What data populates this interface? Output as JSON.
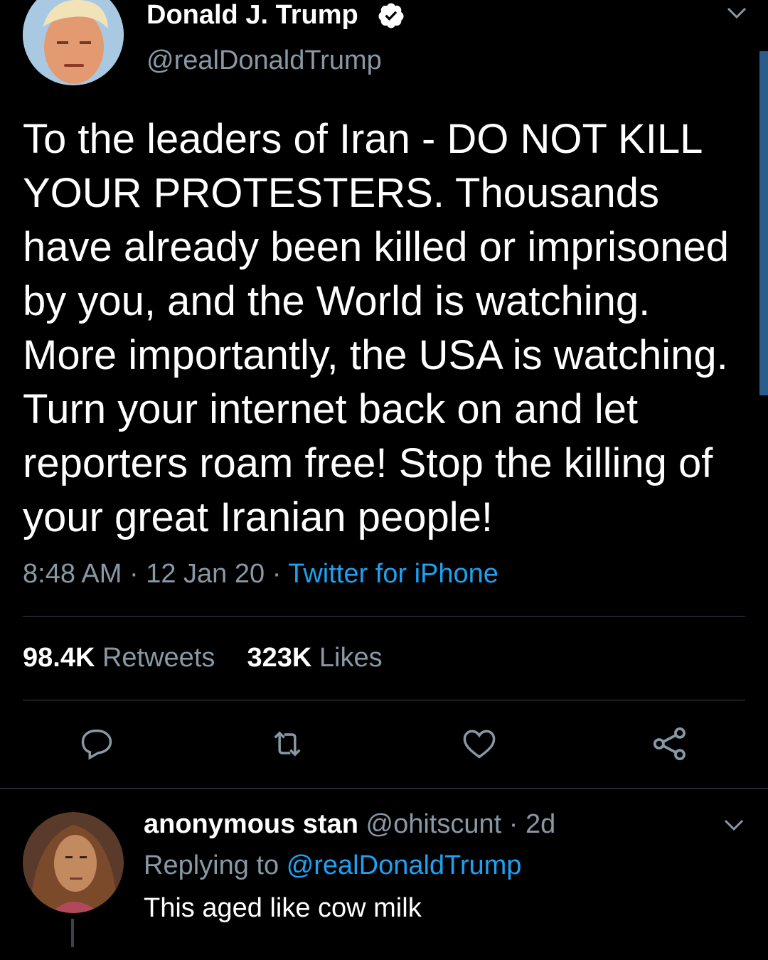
{
  "tweet": {
    "author_name": "Donald J. Trump",
    "author_handle": "@realDonaldTrump",
    "verified": true,
    "text": "To the leaders of Iran - DO NOT KILL YOUR PROTESTERS. Thousands have already been killed or imprisoned by you, and the World is watching. More importantly, the USA is watching. Turn your internet back on and let reporters roam free! Stop the killing of your great Iranian people!",
    "time": "8:48 AM",
    "date": "12 Jan 20",
    "source": "Twitter for iPhone",
    "separator": "·",
    "retweets_count": "98.4K",
    "retweets_label": "Retweets",
    "likes_count": "323K",
    "likes_label": "Likes"
  },
  "reply": {
    "author_name": "anonymous stan",
    "author_handle": "@ohitscunt",
    "age": "· 2d",
    "replying_prefix": "Replying to",
    "replying_to": "@realDonaldTrump",
    "text": "This aged like cow milk"
  },
  "colors": {
    "background": "#000000",
    "secondary_text": "#8899a6",
    "link": "#1da1f2",
    "divider": "#38444d",
    "verified": "#ffffff"
  },
  "icons": [
    "chevron-down-icon",
    "verified-badge-icon",
    "reply-icon",
    "retweet-icon",
    "like-icon",
    "share-icon"
  ]
}
